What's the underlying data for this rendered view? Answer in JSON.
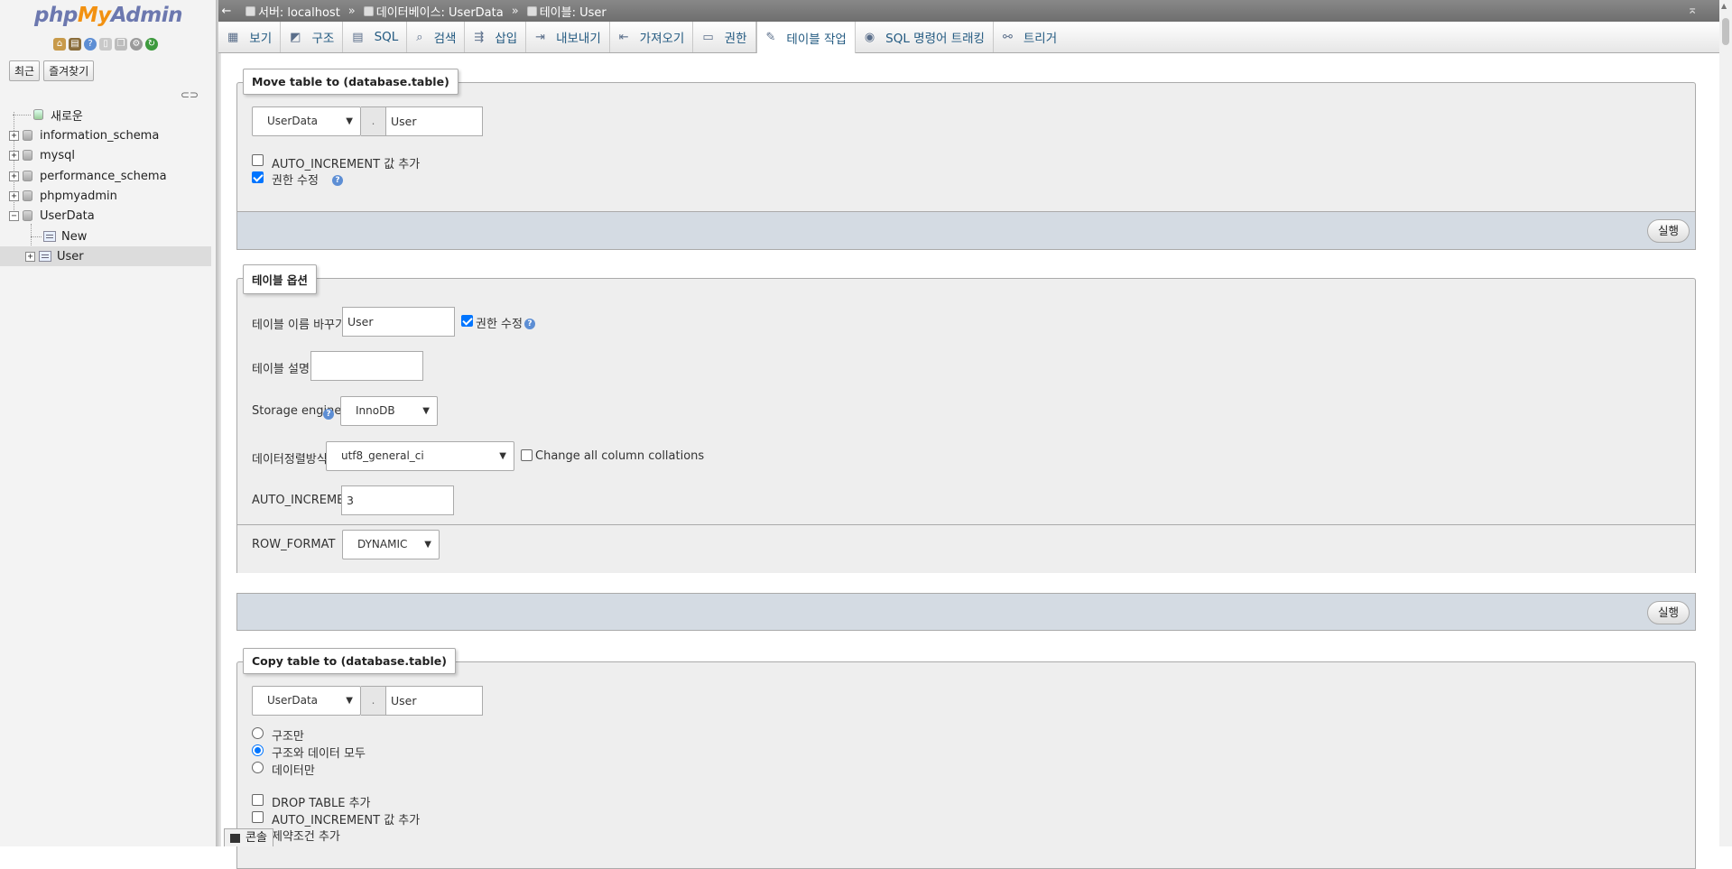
{
  "sidebar": {
    "logo_php": "php",
    "logo_my": "My",
    "logo_admin": "Admin",
    "tabs": [
      "최근",
      "즐겨찾기"
    ],
    "tree": [
      {
        "label": "새로운",
        "type": "new"
      },
      {
        "label": "information_schema",
        "type": "db"
      },
      {
        "label": "mysql",
        "type": "db"
      },
      {
        "label": "performance_schema",
        "type": "db"
      },
      {
        "label": "phpmyadmin",
        "type": "db"
      },
      {
        "label": "UserData",
        "type": "db-open"
      },
      {
        "label": "New",
        "type": "new-table"
      },
      {
        "label": "User",
        "type": "table"
      }
    ]
  },
  "breadcrumb": {
    "server_label": "서버: localhost",
    "database_label": "데이터베이스: UserData",
    "table_label": "테이블: User",
    "separator": "»"
  },
  "tabs": [
    {
      "label": "보기",
      "icon": "browse-icon"
    },
    {
      "label": "구조",
      "icon": "structure-icon"
    },
    {
      "label": "SQL",
      "icon": "sql-icon"
    },
    {
      "label": "검색",
      "icon": "search-icon"
    },
    {
      "label": "삽입",
      "icon": "insert-icon"
    },
    {
      "label": "내보내기",
      "icon": "export-icon"
    },
    {
      "label": "가져오기",
      "icon": "import-icon"
    },
    {
      "label": "권한",
      "icon": "privileges-icon"
    },
    {
      "label": "테이블 작업",
      "icon": "wrench-icon",
      "active": true
    },
    {
      "label": "SQL 명령어 트래킹",
      "icon": "eye-icon"
    },
    {
      "label": "트리거",
      "icon": "triggers-icon"
    }
  ],
  "move": {
    "legend": "Move table to (database.table)",
    "db_value": "UserData",
    "dot": ".",
    "table_value": "User",
    "auto_increment_label": "AUTO_INCREMENT 값 추가",
    "auto_increment_checked": false,
    "adjust_privileges_label": "권한 수정",
    "adjust_privileges_checked": true,
    "go": "실행"
  },
  "options": {
    "legend": "테이블 옵션",
    "rename_label": "테이블 이름 바꾸기",
    "rename_value": "User",
    "adjust_privileges_label": "권한 수정",
    "comment_label": "테이블 설명",
    "comment_value": "",
    "engine_label": "Storage engine",
    "engine_value": "InnoDB",
    "collation_label": "데이터정렬방식",
    "collation_value": "utf8_general_ci",
    "change_all_label": "Change all column collations",
    "auto_increment_label": "AUTO_INCREMENT",
    "auto_increment_value": "3",
    "row_format_label": "ROW_FORMAT",
    "row_format_value": "DYNAMIC",
    "go": "실행"
  },
  "copy": {
    "legend": "Copy table to (database.table)",
    "db_value": "UserData",
    "dot": ".",
    "table_value": "User",
    "radio_structure_only": "구조만",
    "radio_structure_data": "구조와 데이터 모두",
    "radio_data_only": "데이터만",
    "drop_table_label": "DROP TABLE 추가",
    "auto_increment_label": "AUTO_INCREMENT 값 추가",
    "constraints_label": "제약조건 추가"
  },
  "console": {
    "label": "콘솔"
  }
}
